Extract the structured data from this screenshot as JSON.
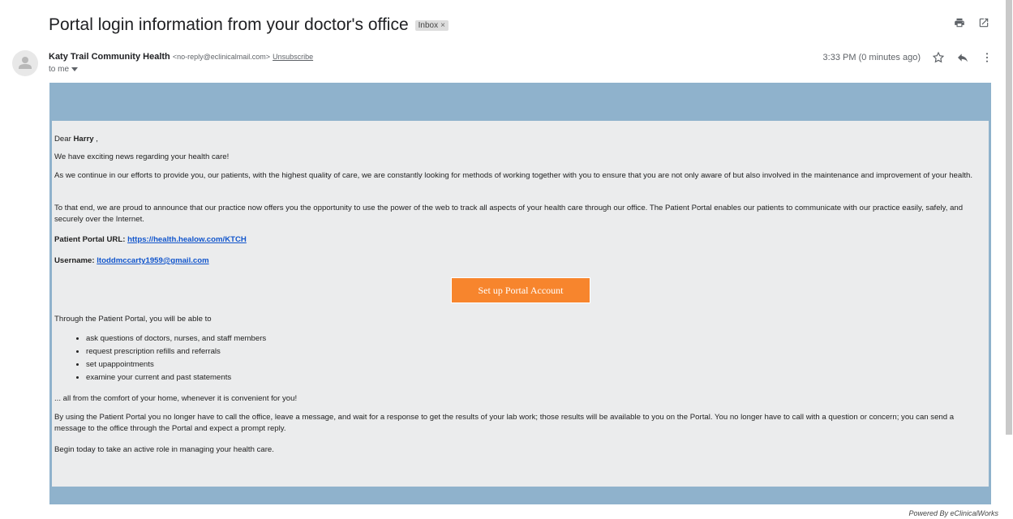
{
  "email": {
    "subject": "Portal login information from your doctor's office",
    "label_chip": "Inbox",
    "label_chip_close": "×",
    "sender_name": "Katy Trail Community Health",
    "sender_email": "<no-reply@eclinicalmail.com>",
    "unsubscribe": "Unsubscribe",
    "to": "to me",
    "time": "3:33 PM (0 minutes ago)"
  },
  "icons": {
    "print": "print-icon",
    "open_new_window": "open-in-new-window-icon",
    "star": "star-icon",
    "reply": "reply-icon",
    "more": "more-vertical-icon",
    "avatar": "person-icon",
    "dropdown": "chevron-down-icon"
  },
  "body": {
    "greeting_prefix": "Dear ",
    "greeting_name": "Harry",
    "greeting_suffix": " ,",
    "p1": "We have exciting news regarding your health care!",
    "p2": "As we continue in our efforts to provide you, our patients, with the highest quality of care, we are constantly looking for methods of working together with you to ensure that you are not only aware of but also involved in the maintenance and improvement of your health.",
    "p3": "To that end, we are proud to announce that our practice now offers you the opportunity to use the power of the web to track all aspects of your health care through our office.  The Patient Portal enables our patients to communicate with our practice easily, safely, and securely over the Internet.",
    "portal_url_label": "Patient Portal URL: ",
    "portal_url": "https://health.healow.com/KTCH",
    "username_label": "Username: ",
    "username": "ltoddmccarty1959@gmail.com",
    "cta": "Set up Portal Account",
    "p4": "Through the Patient Portal, you will be able to",
    "bullets": [
      "ask questions of doctors, nurses, and staff members",
      "request prescription refills and referrals",
      "set upappointments",
      "examine your current and past statements"
    ],
    "p5": "... all from the comfort of your home, whenever it is convenient for you!",
    "p6": "By using the Patient Portal you no longer have to call the office, leave a message, and wait for a response to get the results of your lab work; those results will be available to you on the Portal.  You no longer have to call with a question or concern; you can send a message to the office through the Portal and expect a prompt reply.",
    "p7": "Begin today to take an active role in managing your health care."
  },
  "footer": {
    "powered": "Powered By eClinicalWorks"
  },
  "colors": {
    "banner": "#8fb2cc",
    "content_bg": "#ebeced",
    "cta_bg": "#f7852d",
    "link": "#1155cc"
  }
}
